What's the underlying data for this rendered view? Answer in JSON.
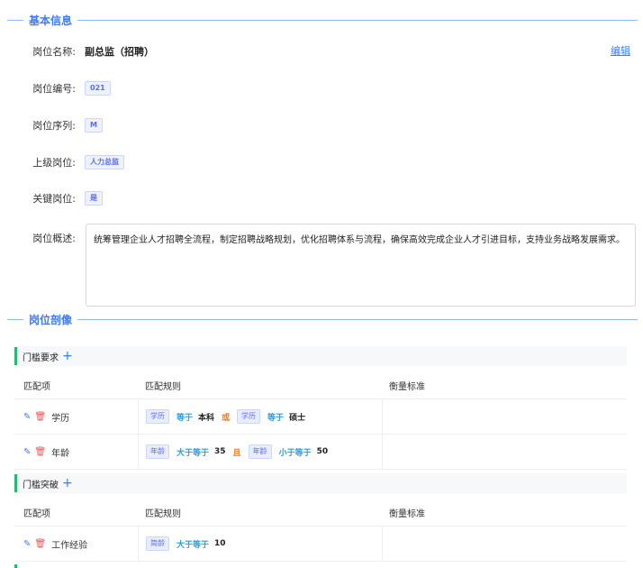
{
  "basic": {
    "section_title": "基本信息",
    "edit_label": "编辑",
    "rows": [
      {
        "label": "岗位名称:",
        "value": "副总监（招聘）"
      },
      {
        "label": "岗位编号:",
        "tag": "021"
      },
      {
        "label": "岗位序列:",
        "tag": "M"
      },
      {
        "label": "上级岗位:",
        "tag": "人力总监"
      },
      {
        "label": "关键岗位:",
        "tag": "是"
      },
      {
        "label": "岗位概述:",
        "text": "统筹管理企业人才招聘全流程，制定招聘战略规划，优化招聘体系与流程，确保高效完成企业人才引进目标，支持业务战略发展需求。"
      }
    ]
  },
  "portrait": {
    "section_title": "岗位剖像",
    "columns": [
      "匹配项",
      "匹配规则",
      "衡量标准"
    ],
    "groups": [
      {
        "title": "门槛要求",
        "rows": [
          {
            "item": "学历",
            "rule": [
              {
                "tag": "学历",
                "op": "等于",
                "val": "本科"
              },
              {
                "logic": "或"
              },
              {
                "tag": "学历",
                "op": "等于",
                "val": "硕士"
              }
            ]
          },
          {
            "item": "年龄",
            "rule": [
              {
                "tag": "年龄",
                "op": "大于等于",
                "val": "35"
              },
              {
                "logic": "且"
              },
              {
                "tag": "年龄",
                "op": "小于等于",
                "val": "50"
              }
            ]
          }
        ]
      },
      {
        "title": "门槛突破",
        "rows": [
          {
            "item": "工作经验",
            "rule": [
              {
                "tag": "简龄",
                "op": "大于等于",
                "val": "10"
              }
            ]
          }
        ]
      }
    ]
  },
  "icons": {
    "edit": "pencil-icon",
    "delete": "trash-icon",
    "add": "plus-icon"
  },
  "colors": {
    "accent": "#3a7afe",
    "group_bar": "#2bb673",
    "logic": "#f07b24",
    "operator": "#2d9cdb"
  }
}
